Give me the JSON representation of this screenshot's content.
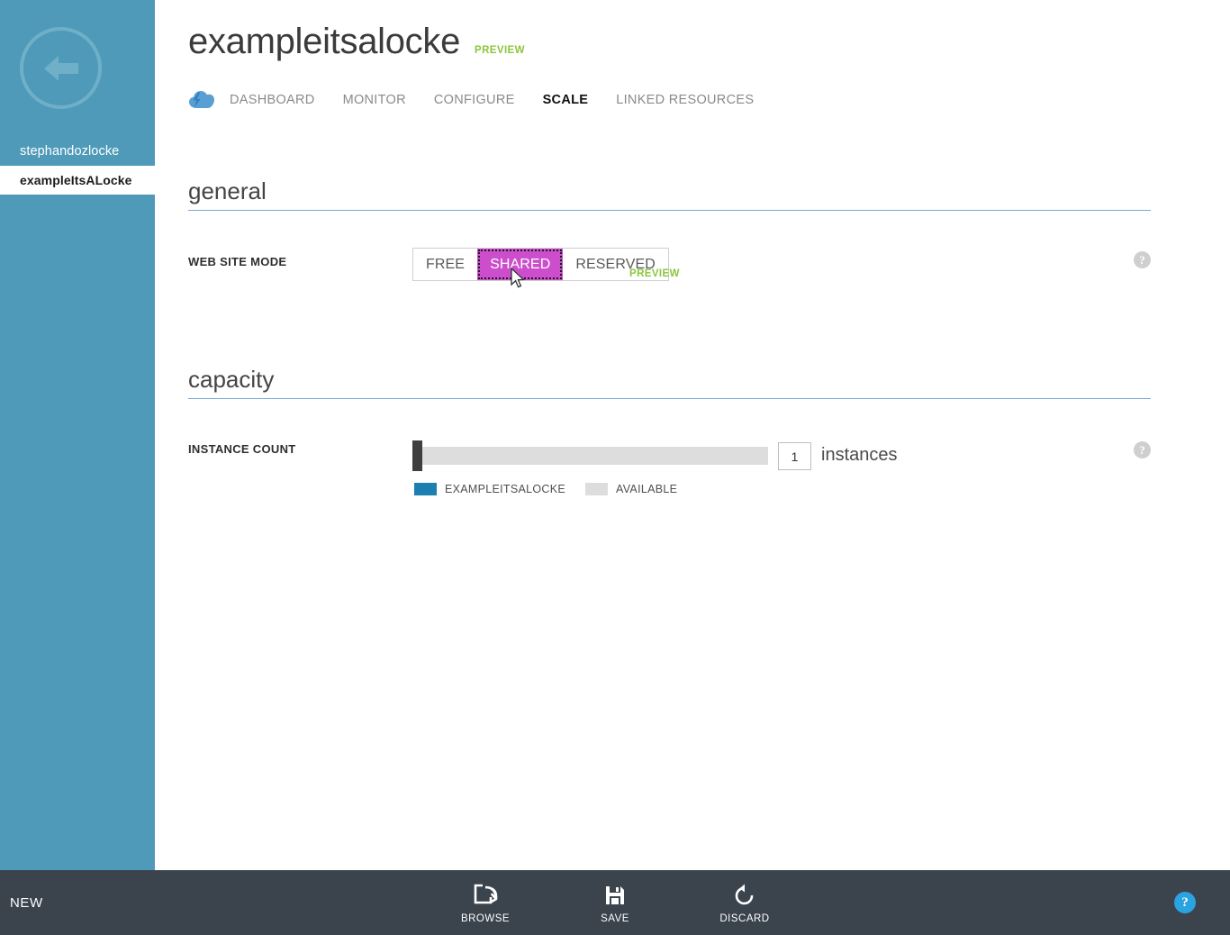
{
  "sidebar": {
    "back_icon": "back-arrow-icon",
    "items": [
      {
        "label": "stephandozlocke",
        "level": 0,
        "active": false
      },
      {
        "label": "exampleItsALocke",
        "level": 1,
        "active": true
      }
    ]
  },
  "header": {
    "title": "exampleitsalocke",
    "preview_badge": "PREVIEW",
    "service_icon": "cloud-lightning-icon",
    "tabs": [
      {
        "label": "DASHBOARD",
        "active": false
      },
      {
        "label": "MONITOR",
        "active": false
      },
      {
        "label": "CONFIGURE",
        "active": false
      },
      {
        "label": "SCALE",
        "active": true
      },
      {
        "label": "LINKED RESOURCES",
        "active": false
      }
    ]
  },
  "sections": {
    "general": {
      "title": "general",
      "web_site_mode": {
        "label": "WEB SITE MODE",
        "options": [
          "FREE",
          "SHARED",
          "RESERVED"
        ],
        "selected": "SHARED",
        "preview_note": "PREVIEW",
        "help": "?",
        "selected_color": "#cc4ecc"
      }
    },
    "capacity": {
      "title": "capacity",
      "instance_count": {
        "label": "INSTANCE COUNT",
        "value": "1",
        "unit": "instances",
        "help": "?",
        "slider_percent": 0,
        "legend": [
          {
            "label": "EXAMPLEITSALOCKE",
            "color": "#1c7fb0"
          },
          {
            "label": "AVAILABLE",
            "color": "#dddddd"
          }
        ]
      }
    }
  },
  "bottombar": {
    "new_label": "NEW",
    "commands": [
      {
        "label": "BROWSE",
        "icon": "browse-icon"
      },
      {
        "label": "SAVE",
        "icon": "save-icon"
      },
      {
        "label": "DISCARD",
        "icon": "discard-icon"
      }
    ],
    "help_label": "?"
  }
}
